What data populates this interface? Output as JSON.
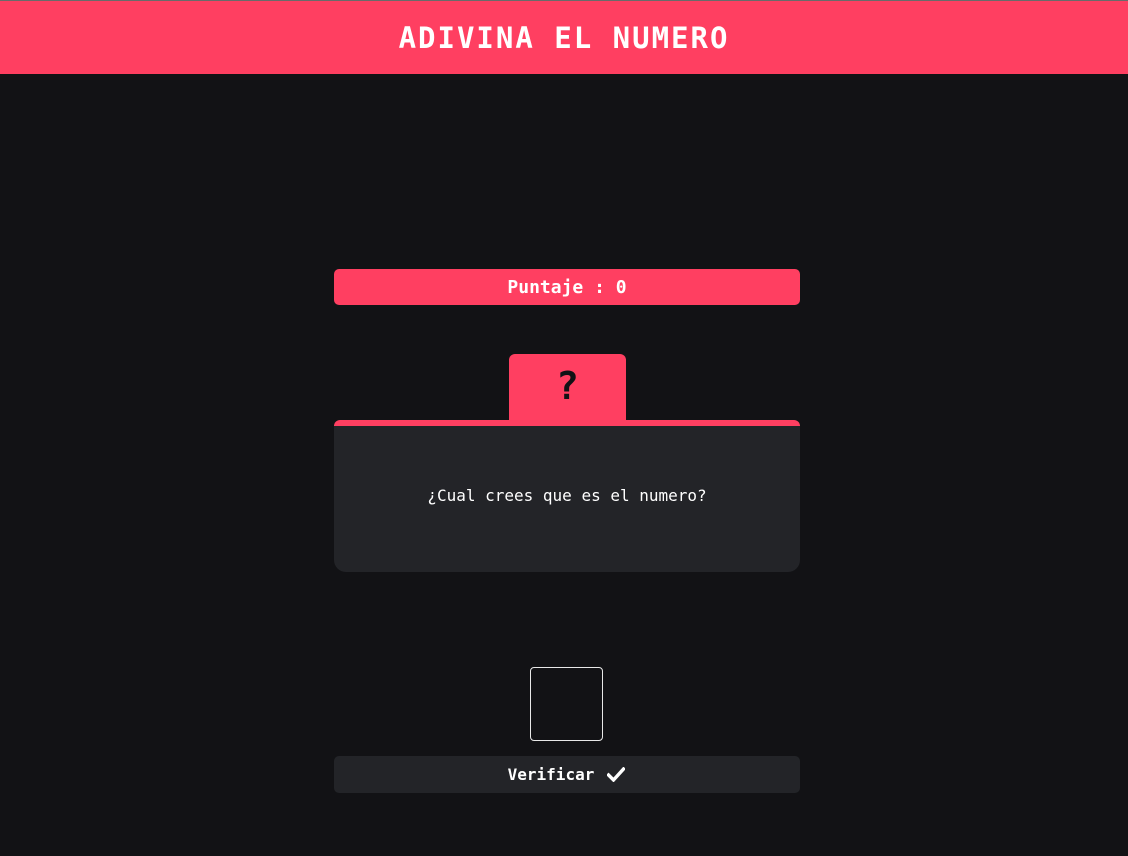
{
  "header": {
    "title": "ADIVINA EL NUMERO"
  },
  "score": {
    "label": "Puntaje : 0"
  },
  "mystery": {
    "symbol": "?"
  },
  "card": {
    "prompt": "¿Cual crees que es el numero?"
  },
  "guess_input": {
    "value": "",
    "placeholder": ""
  },
  "verify_button": {
    "label": "Verificar",
    "icon": "check-icon"
  },
  "colors": {
    "accent": "#ff3f61",
    "background": "#121215",
    "panel": "#232428",
    "text": "#ffffff"
  }
}
